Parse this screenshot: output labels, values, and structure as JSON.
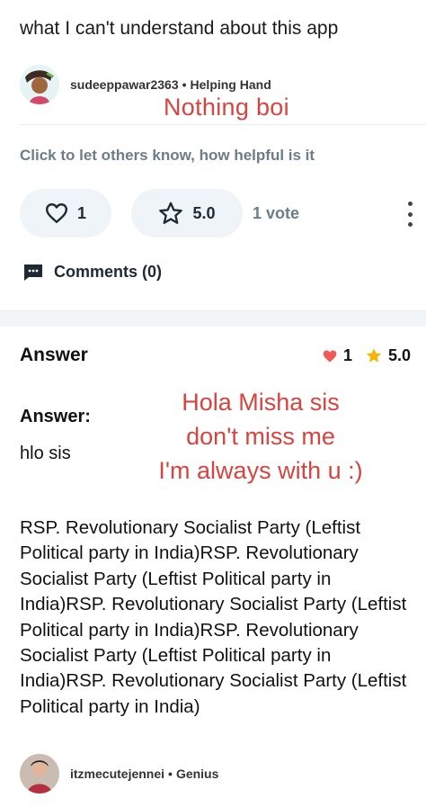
{
  "question": {
    "text": "what I can't understand about this app"
  },
  "answerer": {
    "username": "sudeeppawar2363",
    "rank": "Helping Hand",
    "avatar_icon": "illustrated-avatar"
  },
  "annotations": {
    "top_note": "Nothing boi",
    "answer_note_lines": [
      "Hola Misha sis",
      "don't miss me",
      "I'm always with u :)"
    ]
  },
  "feedback": {
    "hint": "Click to let others know, how helpful is it",
    "likes": "1",
    "rating": "5.0",
    "votes": "1 vote",
    "comments": "Comments (0)"
  },
  "answer": {
    "header": "Answer",
    "likes": "1",
    "rating": "5.0",
    "label": "Answer:",
    "short": "hlo sis",
    "body": "RSP. Revolutionary Socialist Party (Leftist Political party in India)RSP. Revolutionary Socialist Party (Leftist Political party in India)RSP. Revolutionary Socialist Party (Leftist Political party in India)RSP. Revolutionary Socialist Party (Leftist Political party in India)RSP. Revolutionary Socialist Party (Leftist Political party in India)"
  },
  "next_answerer": {
    "username": "itzmecutejennei",
    "rank": "Genius",
    "avatar_icon": "photo-avatar"
  },
  "colors": {
    "accent_red": "#d8443f",
    "pill_bg": "#eef4f7",
    "muted_text": "#6b7d88",
    "heart_filled": "#f05a57",
    "star_filled": "#f7b500"
  }
}
